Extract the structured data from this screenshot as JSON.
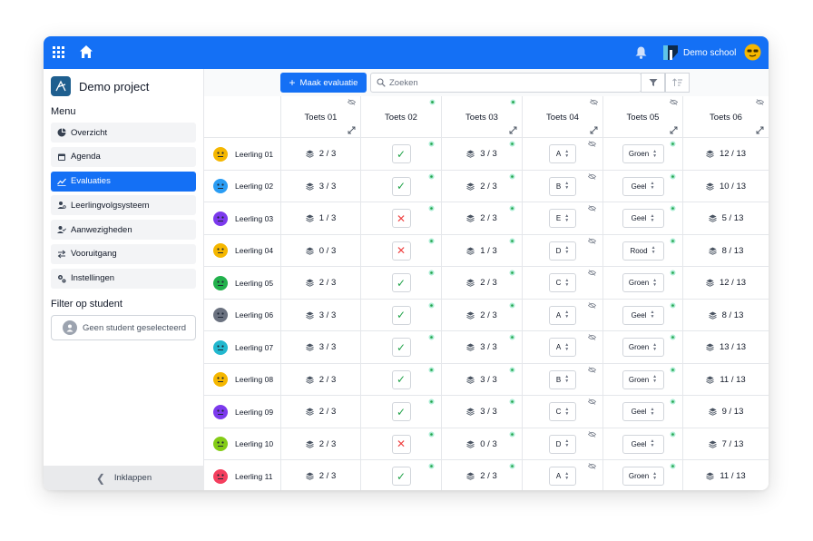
{
  "topbar": {
    "school_name": "Demo school",
    "icons": [
      "grid-icon",
      "home-icon",
      "bell-icon",
      "school-logo-icon",
      "avatar"
    ],
    "color": "#1470f5"
  },
  "sidebar": {
    "project_name": "Demo project",
    "menu_title": "Menu",
    "items": [
      {
        "label": "Overzicht",
        "icon": "pie-chart-icon",
        "active": false
      },
      {
        "label": "Agenda",
        "icon": "calendar-icon",
        "active": false
      },
      {
        "label": "Evaluaties",
        "icon": "trend-icon",
        "active": true
      },
      {
        "label": "Leerlingvolgsysteem",
        "icon": "users-search-icon",
        "active": false
      },
      {
        "label": "Aanwezigheden",
        "icon": "user-check-icon",
        "active": false
      },
      {
        "label": "Vooruitgang",
        "icon": "progress-icon",
        "active": false
      },
      {
        "label": "Instellingen",
        "icon": "settings-icon",
        "active": false
      }
    ],
    "filter_title": "Filter op student",
    "student_placeholder": "Geen student geselecteerd",
    "collapse_label": "Inklappen"
  },
  "toolbar": {
    "new_eval_label": "Maak evaluatie",
    "search_placeholder": "Zoeken"
  },
  "table": {
    "columns": [
      "Toets 01",
      "Toets 02",
      "Toets 03",
      "Toets 04",
      "Toets 05",
      "Toets 06"
    ],
    "rows": [
      {
        "name": "Leerling 01",
        "face": "#f5b700",
        "t1": "2 / 3",
        "t2": "ok",
        "t3": "3 / 3",
        "t4": "A",
        "t5": "Groen",
        "t6": "12 / 13"
      },
      {
        "name": "Leerling 02",
        "face": "#2a9df4",
        "t1": "3 / 3",
        "t2": "ok",
        "t3": "2 / 3",
        "t4": "B",
        "t5": "Geel",
        "t6": "10 / 13"
      },
      {
        "name": "Leerling 03",
        "face": "#7c3aed",
        "t1": "1 / 3",
        "t2": "bad",
        "t3": "2 / 3",
        "t4": "E",
        "t5": "Geel",
        "t6": "5 / 13"
      },
      {
        "name": "Leerling 04",
        "face": "#f5b700",
        "t1": "0 / 3",
        "t2": "bad",
        "t3": "1 / 3",
        "t4": "D",
        "t5": "Rood",
        "t6": "8 / 13"
      },
      {
        "name": "Leerling 05",
        "face": "#22b14c",
        "t1": "2 / 3",
        "t2": "ok",
        "t3": "2 / 3",
        "t4": "C",
        "t5": "Groen",
        "t6": "12 / 13"
      },
      {
        "name": "Leerling 06",
        "face": "#6b7280",
        "t1": "3 / 3",
        "t2": "ok",
        "t3": "2 / 3",
        "t4": "A",
        "t5": "Geel",
        "t6": "8 / 13"
      },
      {
        "name": "Leerling 07",
        "face": "#22b8cf",
        "t1": "3 / 3",
        "t2": "ok",
        "t3": "3 / 3",
        "t4": "A",
        "t5": "Groen",
        "t6": "13 / 13"
      },
      {
        "name": "Leerling 08",
        "face": "#f5b700",
        "t1": "2 / 3",
        "t2": "ok",
        "t3": "3 / 3",
        "t4": "B",
        "t5": "Groen",
        "t6": "11 / 13"
      },
      {
        "name": "Leerling 09",
        "face": "#7c3aed",
        "t1": "2 / 3",
        "t2": "ok",
        "t3": "3 / 3",
        "t4": "C",
        "t5": "Geel",
        "t6": "9 / 13"
      },
      {
        "name": "Leerling 10",
        "face": "#84cc16",
        "t1": "2 / 3",
        "t2": "bad",
        "t3": "0 / 3",
        "t4": "D",
        "t5": "Geel",
        "t6": "7 / 13"
      },
      {
        "name": "Leerling 11",
        "face": "#f43f5e",
        "t1": "2 / 3",
        "t2": "ok",
        "t3": "2 / 3",
        "t4": "A",
        "t5": "Groen",
        "t6": "11 / 13"
      }
    ]
  }
}
